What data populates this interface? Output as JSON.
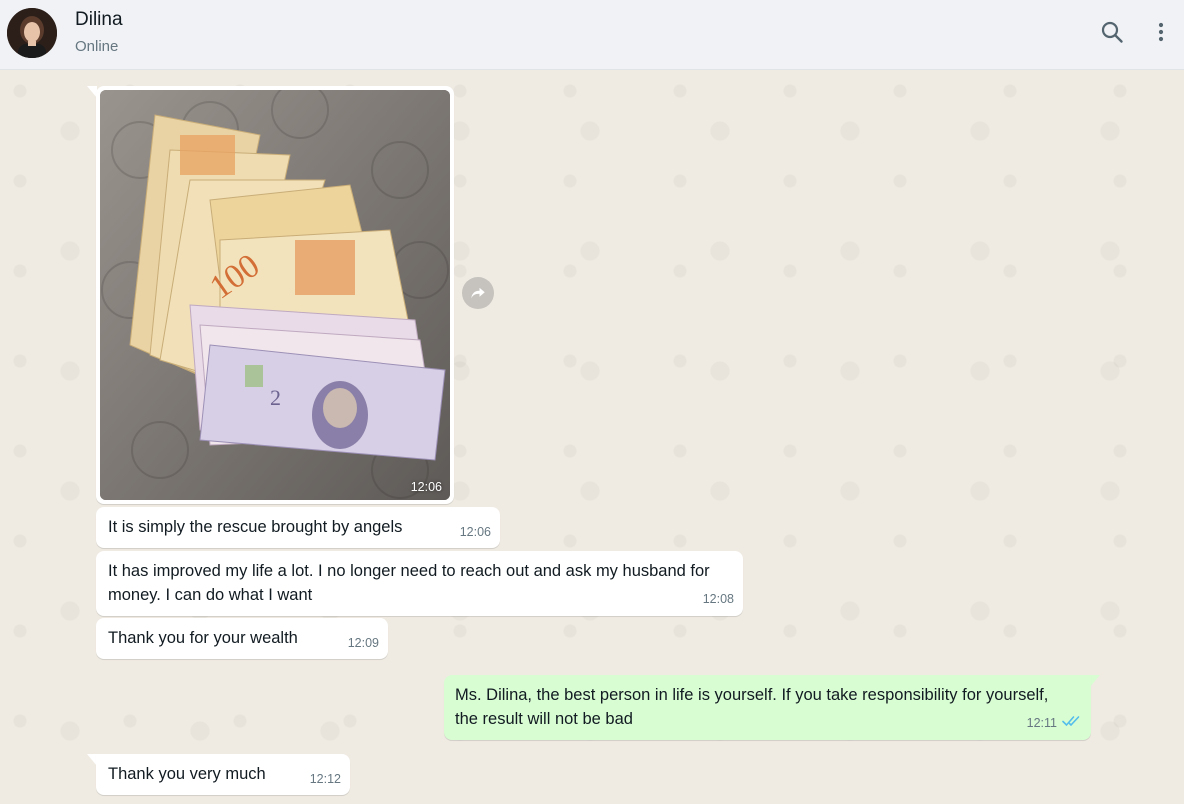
{
  "header": {
    "contact_name": "Dilina",
    "status": "Online",
    "icons": [
      "search-icon",
      "menu-kebab-icon"
    ]
  },
  "colors": {
    "incoming_bubble": "#ffffff",
    "outgoing_bubble": "#d9fdd3",
    "wallpaper": "#efeae2",
    "read_ticks": "#53bdeb"
  },
  "messages": [
    {
      "direction": "in",
      "type": "image",
      "image_alt": "Singapore banknotes",
      "time": "12:06"
    },
    {
      "direction": "in",
      "type": "text",
      "text": "It is simply the rescue brought by angels",
      "time": "12:06"
    },
    {
      "direction": "in",
      "type": "text",
      "text": "It has improved my life a lot. I no longer need to reach out and ask my husband for money. I can do what I want",
      "time": "12:08"
    },
    {
      "direction": "in",
      "type": "text",
      "text": "Thank you for your wealth",
      "time": "12:09"
    },
    {
      "direction": "out",
      "type": "text",
      "text": "Ms. Dilina, the best person in life is yourself. If you take responsibility for yourself, the result will not be bad",
      "time": "12:11",
      "status": "read"
    },
    {
      "direction": "in",
      "type": "text",
      "text": "Thank you very much",
      "time": "12:12"
    }
  ]
}
